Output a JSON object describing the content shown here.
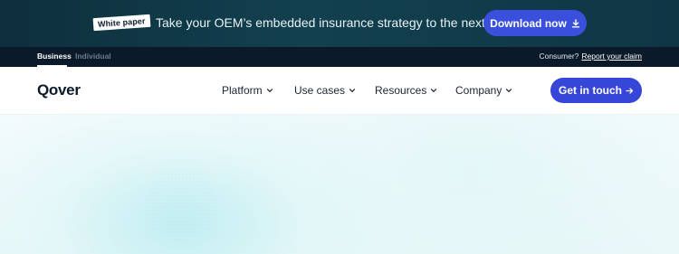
{
  "promo": {
    "badge": "White paper",
    "text": "Take your OEM’s embedded insurance strategy to the next level",
    "button_label": "Download now",
    "button_icon": "download-icon"
  },
  "audience": {
    "tabs": [
      {
        "label": "Business",
        "active": true
      },
      {
        "label": "Individual",
        "active": false
      }
    ],
    "consumer_prefix": "Consumer?",
    "claim_link": "Report your claim"
  },
  "nav": {
    "logo": "Qover",
    "items": [
      {
        "label": "Platform",
        "icon": "chevron-down-icon"
      },
      {
        "label": "Use cases",
        "icon": "chevron-down-icon"
      },
      {
        "label": "Resources",
        "icon": "chevron-down-icon"
      },
      {
        "label": "Company",
        "icon": "chevron-down-icon"
      }
    ],
    "cta_label": "Get in touch",
    "cta_icon": "arrow-right-icon"
  },
  "colors": {
    "promo_bg": "#12404f",
    "audience_bg": "#0b1a2b",
    "accent": "#3646d8",
    "hero_tint": "#eaf8f9"
  }
}
